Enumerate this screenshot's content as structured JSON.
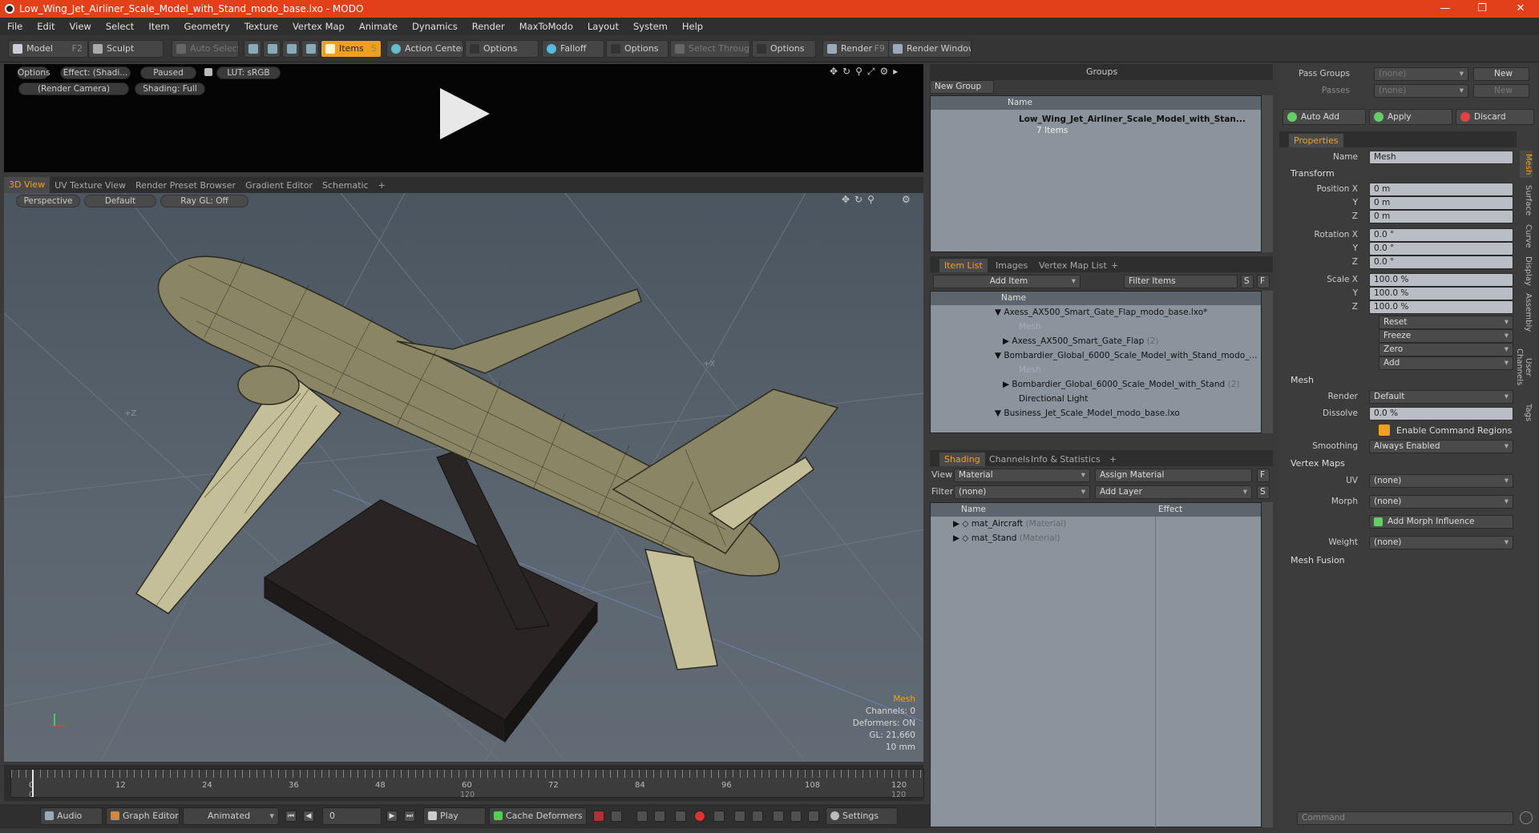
{
  "app": {
    "title": "Low_Wing_Jet_Airliner_Scale_Model_with_Stand_modo_base.lxo - MODO"
  },
  "menu": [
    "File",
    "Edit",
    "View",
    "Select",
    "Item",
    "Geometry",
    "Texture",
    "Vertex Map",
    "Animate",
    "Dynamics",
    "Render",
    "MaxToModo",
    "Layout",
    "System",
    "Help"
  ],
  "toolbar": {
    "model": "Model",
    "model_key": "F2",
    "sculpt": "Sculpt",
    "auto_select": "Auto Select",
    "items": "Items",
    "items_key": "5",
    "action_center": "Action Center",
    "options1": "Options",
    "falloff": "Falloff",
    "options2": "Options",
    "select_through": "Select Through",
    "options3": "Options",
    "render": "Render",
    "render_key": "F9",
    "render_window": "Render Window"
  },
  "preview": {
    "options": "Options",
    "effect": "Effect: (Shadi...",
    "paused": "Paused",
    "lut": "LUT: sRGB",
    "camera": "(Render Camera)",
    "shading": "Shading: Full"
  },
  "viewtabs": [
    "3D View",
    "UV Texture View",
    "Render Preset Browser",
    "Gradient Editor",
    "Schematic",
    "+"
  ],
  "viewport": {
    "perspective": "Perspective",
    "default": "Default",
    "raygl": "Ray GL: Off",
    "axis_z": "+Z",
    "axis_x": "+X",
    "info": {
      "type": "Mesh",
      "channels": "Channels: 0",
      "deformers": "Deformers: ON",
      "gl": "GL: 21,660",
      "scale": "10 mm"
    }
  },
  "timeline": {
    "ticks": [
      "0",
      "12",
      "24",
      "36",
      "48",
      "60",
      "72",
      "84",
      "96",
      "108",
      "120"
    ],
    "sub_ticks": [
      "0",
      "120",
      "120"
    ]
  },
  "bottombar": {
    "audio": "Audio",
    "graph_editor": "Graph Editor",
    "animated": "Animated",
    "frame": "0",
    "play": "Play",
    "cache": "Cache Deformers",
    "settings": "Settings"
  },
  "groups": {
    "title": "Groups",
    "new_group": "New Group",
    "col_name": "Name",
    "item_name": "Low_Wing_Jet_Airliner_Scale_Model_with_Stan...",
    "item_count": "7 Items"
  },
  "itemlist": {
    "tabs": [
      "Item List",
      "Images",
      "Vertex Map List",
      "+"
    ],
    "add_item": "Add Item",
    "filter": "Filter Items",
    "s": "S",
    "f": "F",
    "col_name": "Name",
    "rows": [
      {
        "label": "Axess_AX500_Smart_Gate_Flap_modo_base.lxo*",
        "extra": ""
      },
      {
        "label": "Mesh",
        "extra": ""
      },
      {
        "label": "Axess_AX500_Smart_Gate_Flap",
        "extra": "(2)"
      },
      {
        "label": "Bombardier_Global_6000_Scale_Model_with_Stand_modo_...",
        "extra": ""
      },
      {
        "label": "Mesh",
        "extra": ""
      },
      {
        "label": "Bombardier_Global_6000_Scale_Model_with_Stand",
        "extra": "(2)"
      },
      {
        "label": "Directional Light",
        "extra": ""
      },
      {
        "label": "Business_Jet_Scale_Model_modo_base.lxo",
        "extra": ""
      }
    ]
  },
  "shading": {
    "tabs": [
      "Shading",
      "Channels",
      "Info & Statistics",
      "+"
    ],
    "view_label": "View",
    "view_value": "Material",
    "assign": "Assign Material",
    "f": "F",
    "filter_label": "Filter",
    "filter_value": "(none)",
    "add_layer": "Add Layer",
    "s": "S",
    "col_name": "Name",
    "col_effect": "Effect",
    "rows": [
      {
        "name": "mat_Aircraft",
        "type": "(Material)"
      },
      {
        "name": "mat_Stand",
        "type": "(Material)"
      }
    ]
  },
  "properties": {
    "pass_groups": "Pass Groups",
    "passes": "Passes",
    "none": "(none)",
    "new": "New",
    "auto_add": "Auto Add",
    "apply": "Apply",
    "discard": "Discard",
    "tab": "Properties",
    "name_label": "Name",
    "name_value": "Mesh",
    "transform": "Transform",
    "position_x": "Position X",
    "y": "Y",
    "z": "Z",
    "pos": [
      "0 m",
      "0 m",
      "0 m"
    ],
    "rotation_x": "Rotation X",
    "rot": [
      "0.0 °",
      "0.0 °",
      "0.0 °"
    ],
    "scale_x": "Scale X",
    "scl": [
      "100.0 %",
      "100.0 %",
      "100.0 %"
    ],
    "reset": "Reset",
    "freeze": "Freeze",
    "zero": "Zero",
    "add": "Add",
    "mesh": "Mesh",
    "render_label": "Render",
    "render_value": "Default",
    "dissolve_label": "Dissolve",
    "dissolve_value": "0.0 %",
    "enable_cmd": "Enable Command Regions",
    "smoothing_label": "Smoothing",
    "smoothing_value": "Always Enabled",
    "vertex_maps": "Vertex Maps",
    "uv_label": "UV",
    "uv_value": "(none)",
    "morph_label": "Morph",
    "morph_value": "(none)",
    "add_morph": "Add Morph Influence",
    "weight_label": "Weight",
    "weight_value": "(none)",
    "mesh_fusion": "Mesh Fusion",
    "side_tabs": [
      "Mesh",
      "Surface",
      "Curve",
      "Display",
      "Assembly",
      "User Channels",
      "Tags"
    ],
    "command": "Command"
  }
}
